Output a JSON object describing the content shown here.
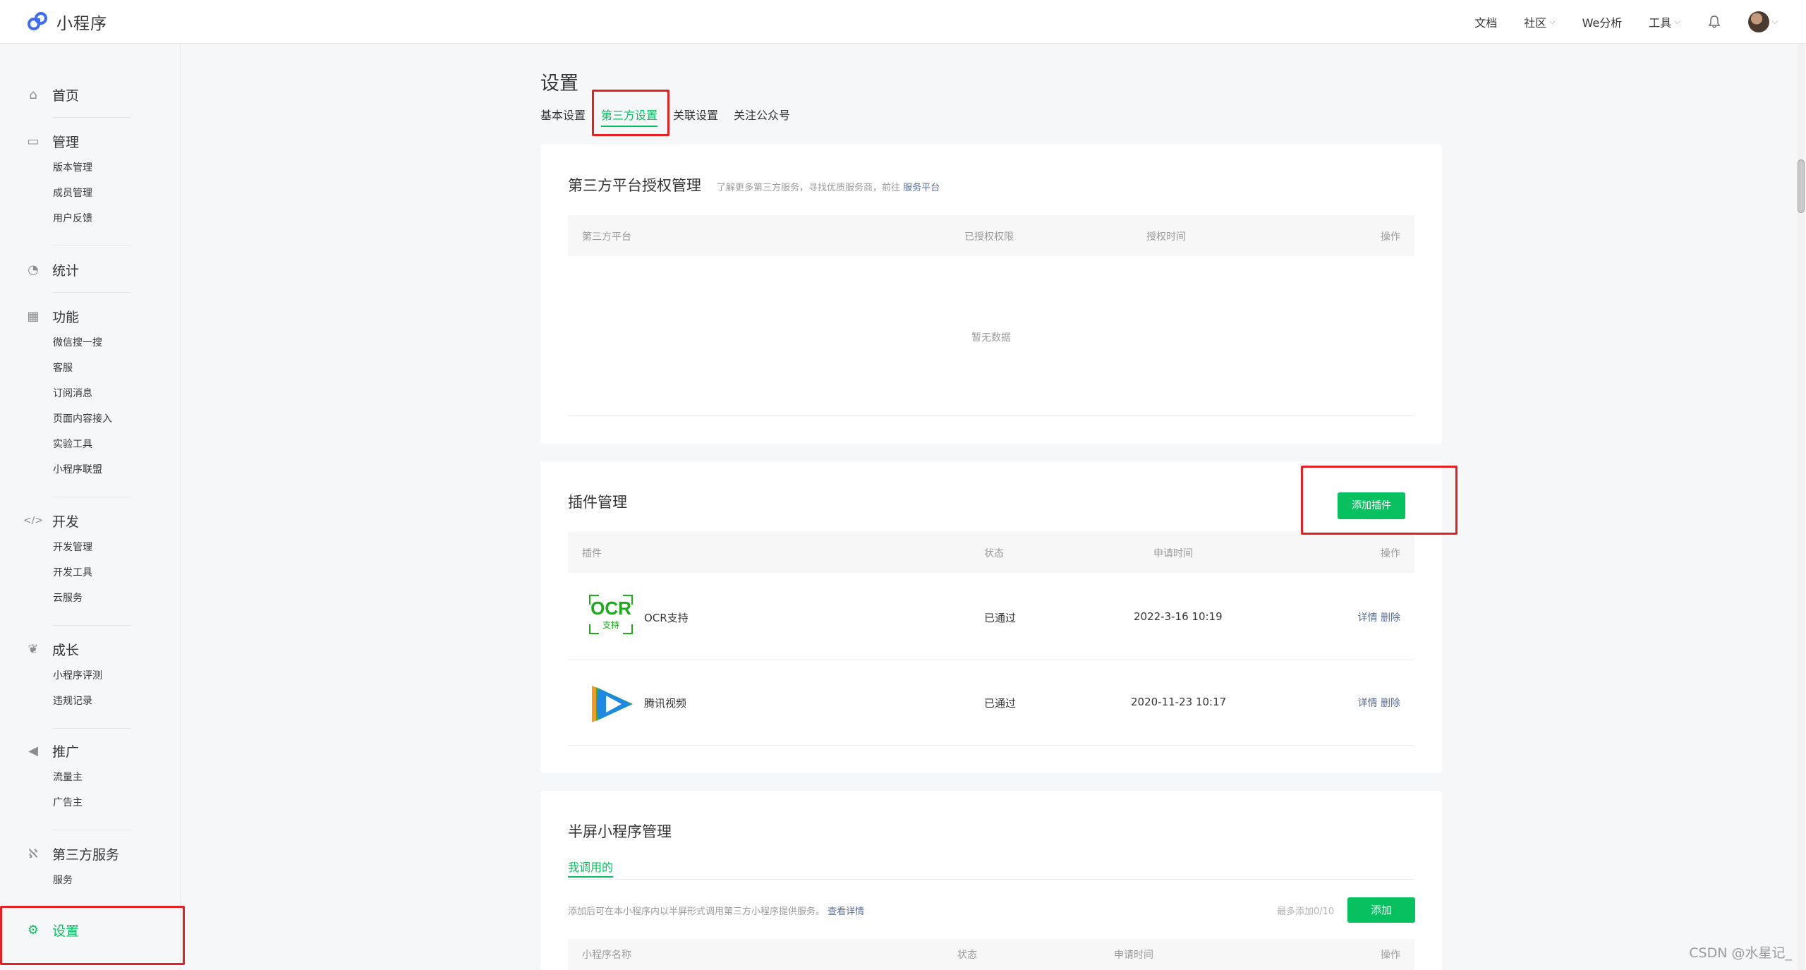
{
  "app": {
    "name": "小程序"
  },
  "topnav": {
    "docs": "文档",
    "community": "社区",
    "we_analysis": "We分析",
    "tools": "工具"
  },
  "sidebar": {
    "home": "首页",
    "manage": {
      "label": "管理",
      "items": [
        "版本管理",
        "成员管理",
        "用户反馈"
      ]
    },
    "stats": "统计",
    "features": {
      "label": "功能",
      "items": [
        "微信搜一搜",
        "客服",
        "订阅消息",
        "页面内容接入",
        "实验工具",
        "小程序联盟"
      ]
    },
    "dev": {
      "label": "开发",
      "items": [
        "开发管理",
        "开发工具",
        "云服务"
      ]
    },
    "growth": {
      "label": "成长",
      "items": [
        "小程序评测",
        "违规记录"
      ]
    },
    "promo": {
      "label": "推广",
      "items": [
        "流量主",
        "广告主"
      ]
    },
    "third": {
      "label": "第三方服务",
      "items": [
        "服务"
      ]
    },
    "settings": "设置"
  },
  "page": {
    "title": "设置",
    "tabs": [
      "基本设置",
      "第三方设置",
      "关联设置",
      "关注公众号"
    ],
    "active_tab": "第三方设置"
  },
  "auth_card": {
    "title": "第三方平台授权管理",
    "desc": "了解更多第三方服务，寻找优质服务商，前往",
    "desc_link": "服务平台",
    "columns": [
      "第三方平台",
      "已授权权限",
      "授权时间",
      "操作"
    ],
    "empty": "暂无数据"
  },
  "plugin_card": {
    "title": "插件管理",
    "add_button": "添加插件",
    "columns": [
      "插件",
      "状态",
      "申请时间",
      "操作"
    ],
    "rows": [
      {
        "name": "OCR支持",
        "logo_text": "OCR",
        "logo_sub": "支持",
        "status": "已通过",
        "time": "2022-3-16 10:19",
        "detail": "详情",
        "delete": "删除",
        "icon": "ocr-logo"
      },
      {
        "name": "腾讯视频",
        "status": "已通过",
        "time": "2020-11-23 10:17",
        "detail": "详情",
        "delete": "删除",
        "icon": "tencent-video-logo"
      }
    ]
  },
  "halfscreen_card": {
    "title": "半屏小程序管理",
    "subtab": "我调用的",
    "desc": "添加后可在本小程序内以半屏形式调用第三方小程序提供服务。",
    "desc_link": "查看详情",
    "limit": "最多添加0/10",
    "add_button": "添加",
    "columns": [
      "小程序名称",
      "状态",
      "申请时间",
      "操作"
    ]
  },
  "watermark": "CSDN @水星记_",
  "colors": {
    "accent": "#07c160",
    "link": "#576b95",
    "highlight": "#e62020"
  }
}
